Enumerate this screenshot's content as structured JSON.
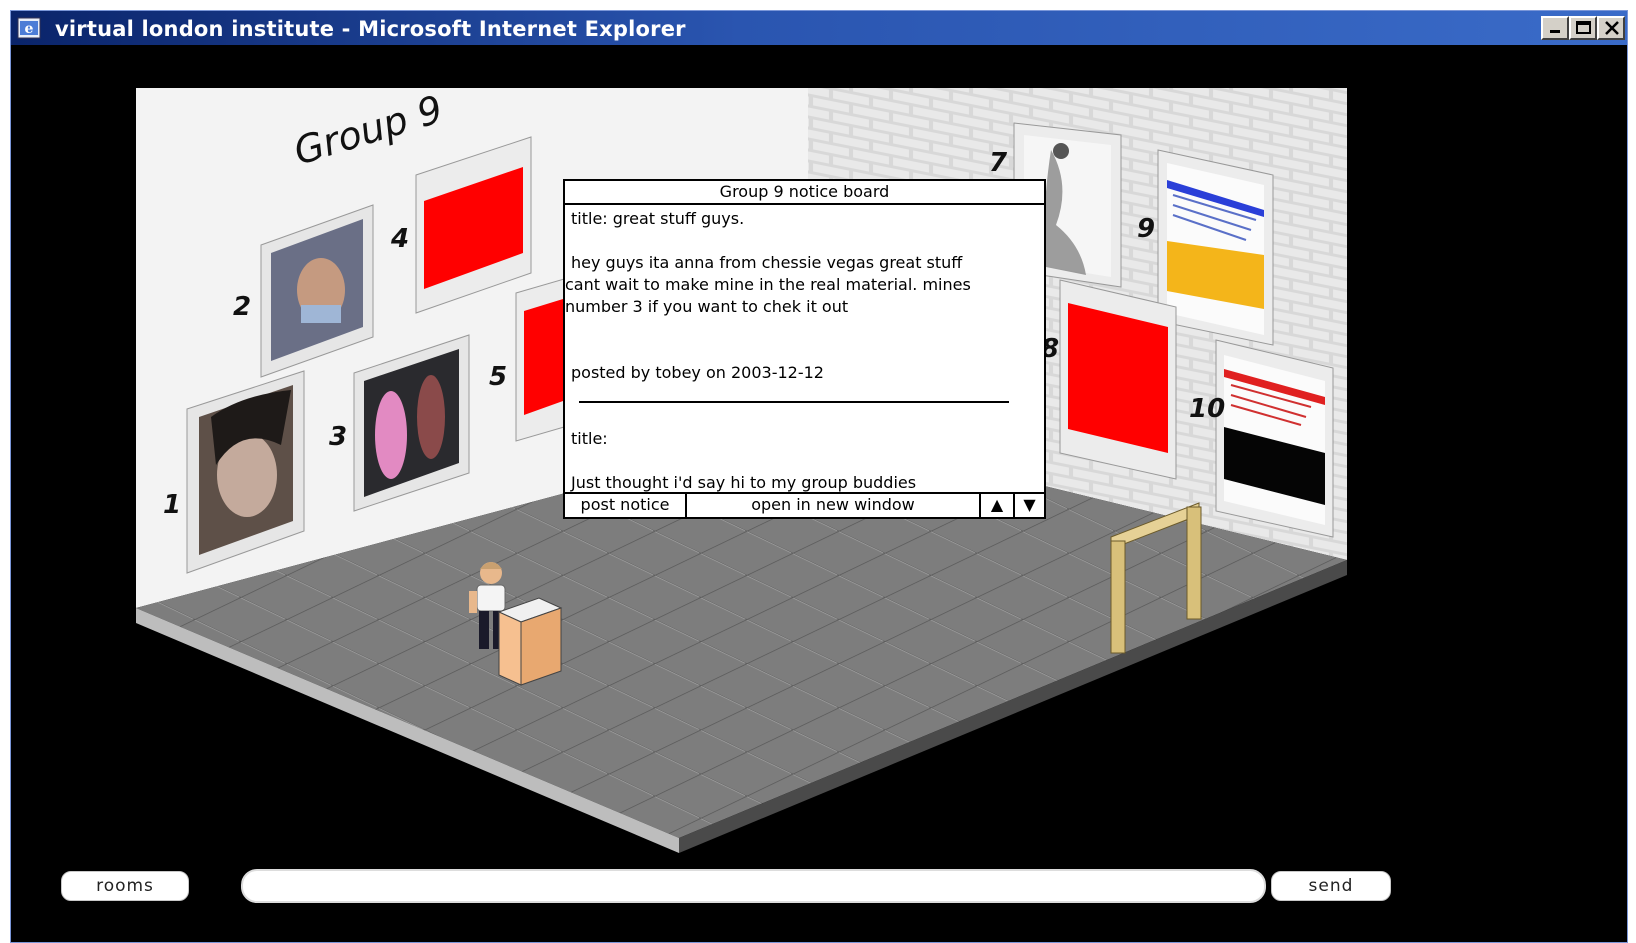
{
  "window": {
    "title": "virtual london institute - Microsoft Internet Explorer",
    "controls": [
      "minimize-icon",
      "maximize-icon",
      "close-icon"
    ]
  },
  "room": {
    "heading": "Group 9",
    "exhibit_numbers": [
      "1",
      "2",
      "3",
      "4",
      "5",
      "7",
      "8",
      "9",
      "10"
    ]
  },
  "notice_board": {
    "header": "Group 9 notice board",
    "posts": [
      {
        "title_line": "title: great stuff guys.",
        "body_lines": [
          "hey guys ita anna from chessie vegas great stuff",
          "cant wait to make mine in the real material. mines",
          "number 3 if you want to chek it out"
        ],
        "posted_by": "posted by tobey on 2003-12-12"
      },
      {
        "title_line": "title:",
        "body_lines": [
          "Just thought i'd say hi to my group buddies"
        ]
      }
    ],
    "post_button": "post notice",
    "open_button": "open in new window",
    "scroll_up": "▲",
    "scroll_down": "▼"
  },
  "bottom_bar": {
    "rooms_label": "rooms",
    "chat_value": "",
    "send_label": "send"
  },
  "colors": {
    "titlebar": "#0a246a",
    "floor": "#7a7a7a",
    "wall": "#f4f4f4",
    "poster_red": "#ff0000"
  }
}
